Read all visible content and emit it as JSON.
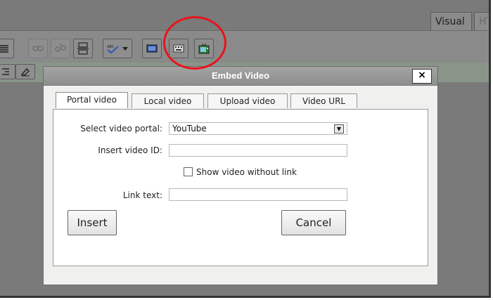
{
  "editor": {
    "tabs": [
      {
        "label": "Visual"
      },
      {
        "label": "HT"
      }
    ]
  },
  "toolbar": {
    "icons": [
      "align-justify-icon",
      "link-icon",
      "unlink-icon",
      "page-break-icon",
      "spellcheck-icon",
      "fullscreen-icon",
      "keyboard-icon",
      "embed-video-icon"
    ]
  },
  "dialog": {
    "title": "Embed Video",
    "close_label": "×",
    "tabs": [
      {
        "label": "Portal video",
        "active": true
      },
      {
        "label": "Local video"
      },
      {
        "label": "Upload video"
      },
      {
        "label": "Video URL"
      }
    ],
    "form": {
      "portal_label": "Select video portal:",
      "portal_value": "YouTube",
      "video_id_label": "Insert video ID:",
      "video_id_value": "",
      "no_link_label": "Show video without link",
      "link_text_label": "Link text:",
      "link_text_value": ""
    },
    "insert_label": "Insert",
    "cancel_label": "Cancel"
  },
  "highlight_color": "#e8141c"
}
